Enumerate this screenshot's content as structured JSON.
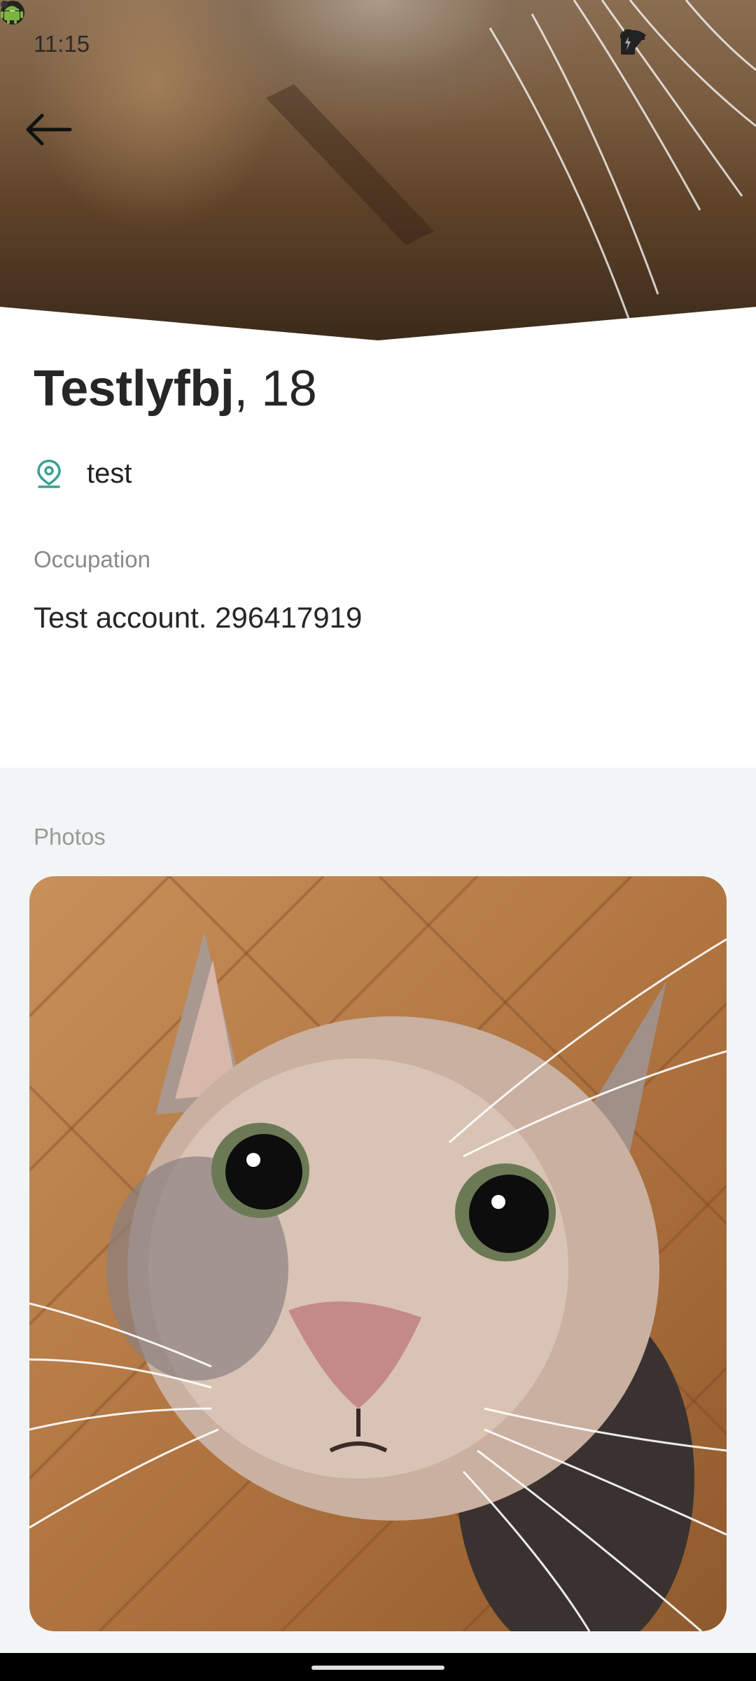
{
  "status_bar": {
    "time": "11:15",
    "left_icons": [
      "notification-icon",
      "notification-icon",
      "app-icon",
      "android-icon",
      "dot-icon"
    ],
    "right_icons": [
      "vpn-key-icon",
      "wifi-icon",
      "battery-icon"
    ]
  },
  "profile": {
    "name": "Testlyfbj",
    "age": ", 18",
    "location": "test",
    "occupation_label": "Occupation",
    "occupation_value": "Test account. 296417919"
  },
  "photos": {
    "label": "Photos"
  },
  "colors": {
    "accent": "#3aa18f",
    "text_primary": "#262626",
    "text_secondary": "#8a8a8a",
    "section_bg": "#f2f5f5"
  }
}
